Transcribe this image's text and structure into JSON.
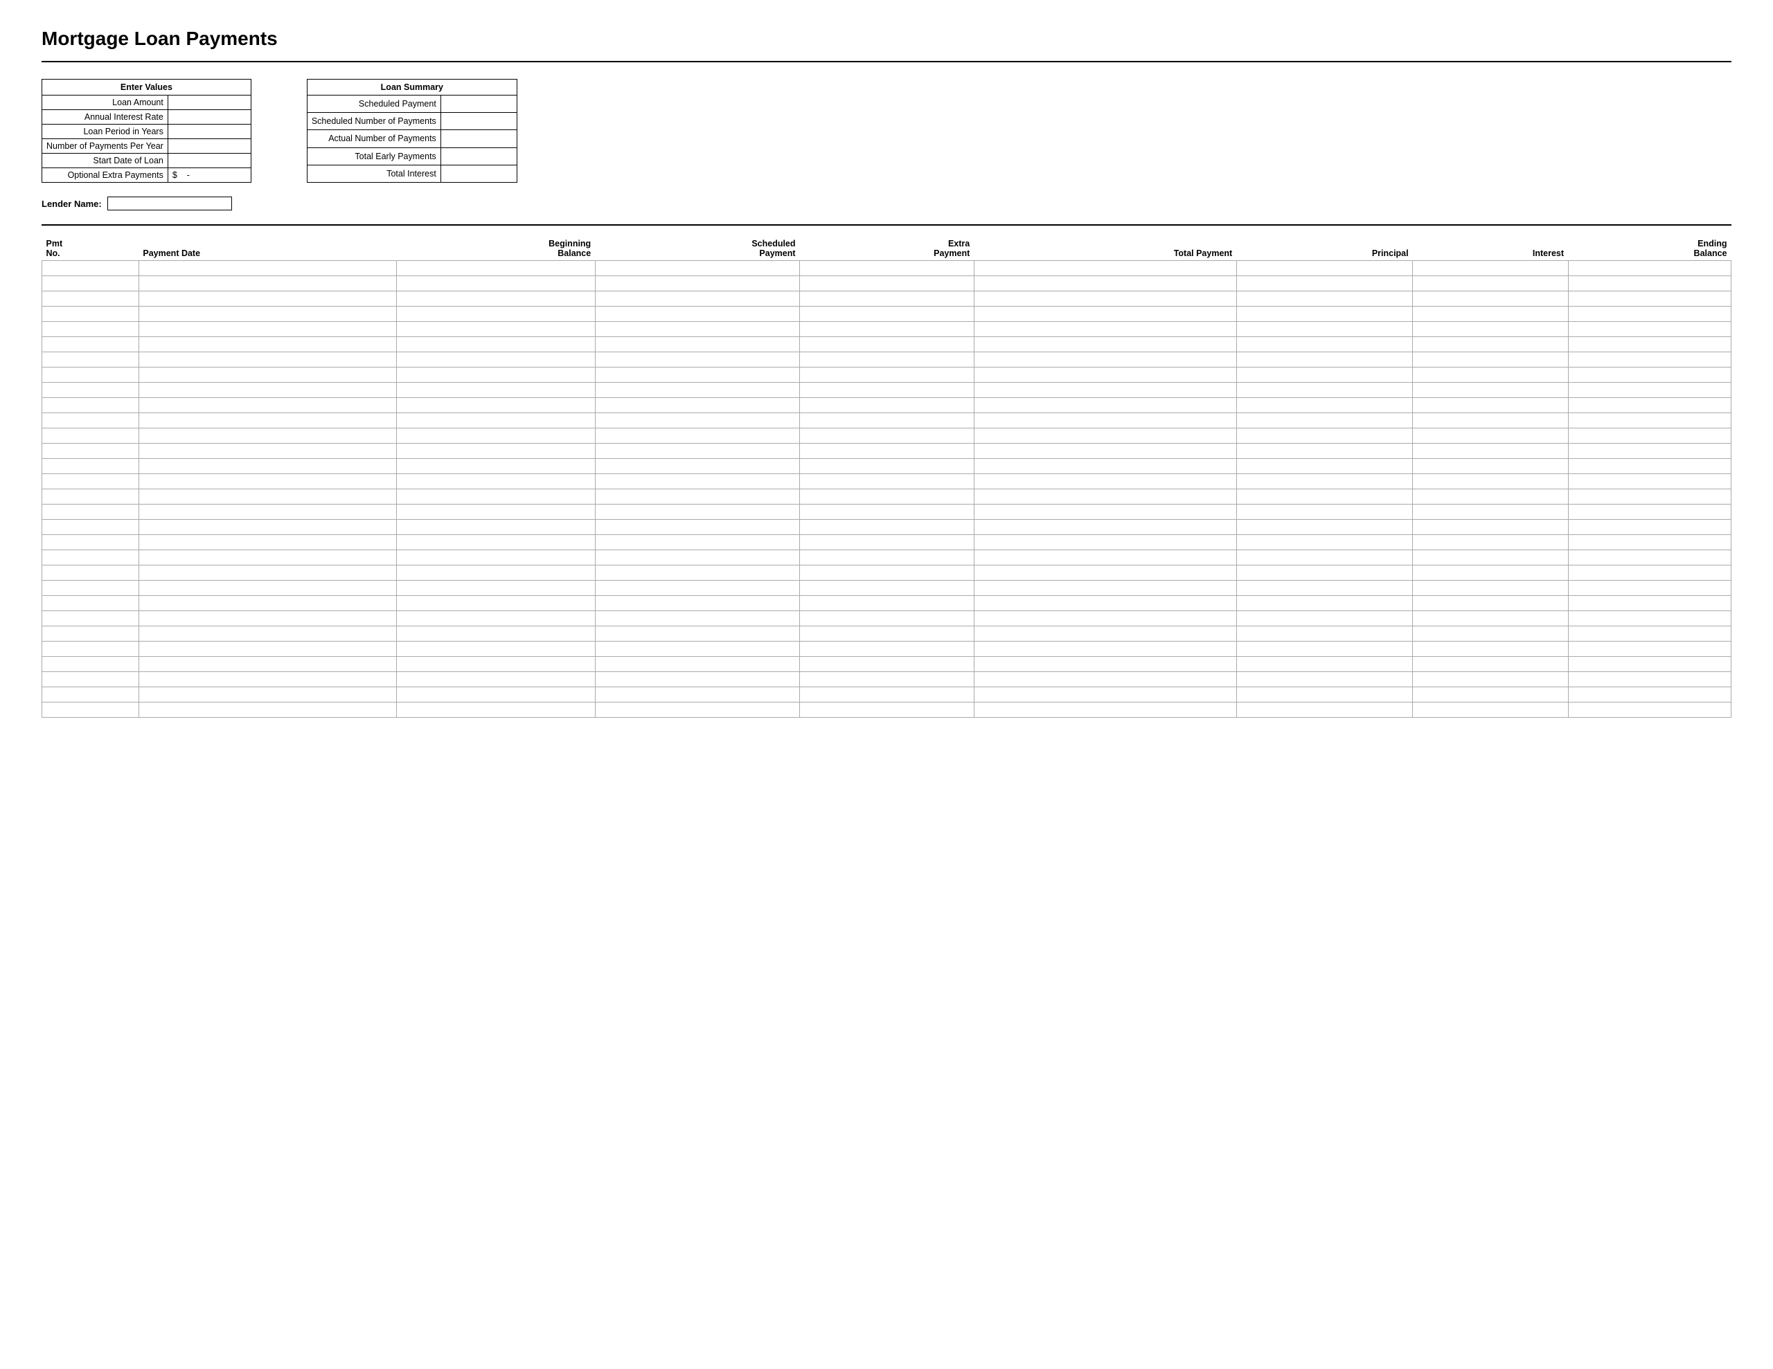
{
  "page": {
    "title": "Mortgage Loan Payments"
  },
  "enter_values": {
    "header": "Enter Values",
    "fields": [
      {
        "label": "Loan Amount",
        "value": ""
      },
      {
        "label": "Annual Interest Rate",
        "value": ""
      },
      {
        "label": "Loan Period in Years",
        "value": ""
      },
      {
        "label": "Number of Payments Per Year",
        "value": ""
      },
      {
        "label": "Start Date of Loan",
        "value": ""
      },
      {
        "label": "Optional Extra Payments",
        "value": "-",
        "prefix": "$"
      }
    ]
  },
  "loan_summary": {
    "header": "Loan Summary",
    "fields": [
      {
        "label": "Scheduled Payment",
        "value": ""
      },
      {
        "label": "Scheduled Number of Payments",
        "value": ""
      },
      {
        "label": "Actual Number of Payments",
        "value": ""
      },
      {
        "label": "Total Early Payments",
        "value": ""
      },
      {
        "label": "Total Interest",
        "value": ""
      }
    ]
  },
  "lender": {
    "label": "Lender Name:",
    "value": ""
  },
  "payment_table": {
    "columns": [
      {
        "id": "pmt_no",
        "line1": "Pmt",
        "line2": "No.",
        "align": "left"
      },
      {
        "id": "payment_date",
        "line1": "",
        "line2": "Payment Date",
        "align": "left"
      },
      {
        "id": "beginning_balance",
        "line1": "Beginning",
        "line2": "Balance",
        "align": "right"
      },
      {
        "id": "scheduled_payment",
        "line1": "Scheduled",
        "line2": "Payment",
        "align": "right"
      },
      {
        "id": "extra_payment",
        "line1": "Extra",
        "line2": "Payment",
        "align": "right"
      },
      {
        "id": "total_payment",
        "line1": "",
        "line2": "Total Payment",
        "align": "right"
      },
      {
        "id": "principal",
        "line1": "",
        "line2": "Principal",
        "align": "right"
      },
      {
        "id": "interest",
        "line1": "",
        "line2": "Interest",
        "align": "right"
      },
      {
        "id": "ending_balance",
        "line1": "Ending",
        "line2": "Balance",
        "align": "right"
      }
    ],
    "row_count": 30
  }
}
